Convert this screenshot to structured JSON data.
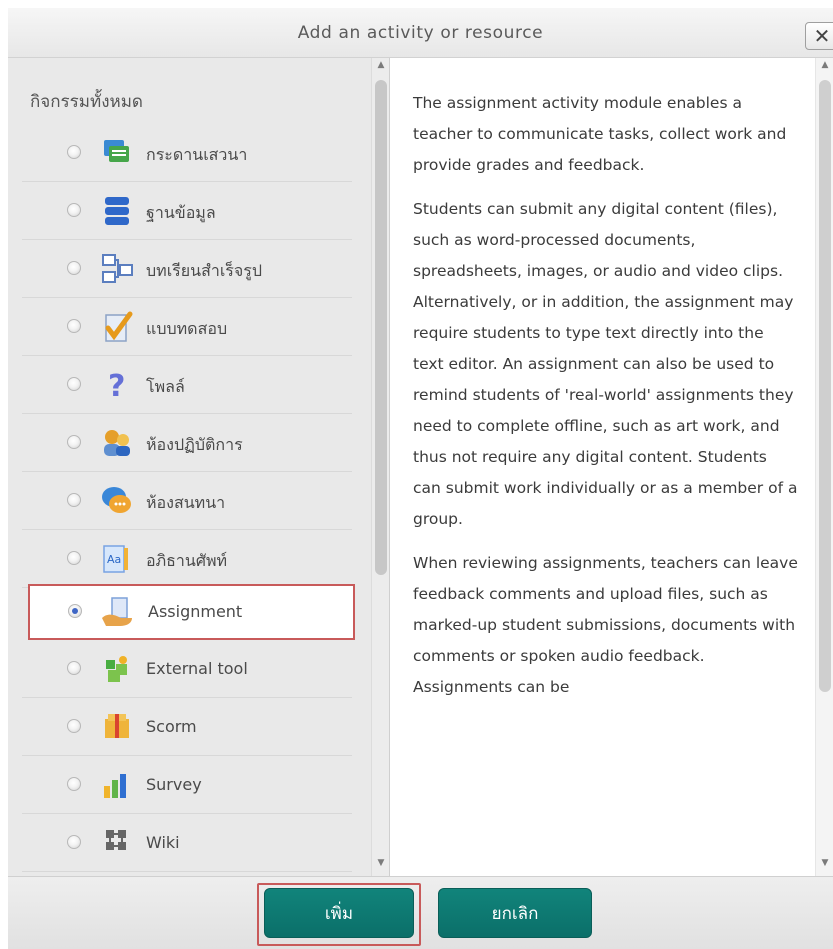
{
  "dialog": {
    "title": "Add an activity or resource",
    "close_label": "✕"
  },
  "left_panel": {
    "heading": "กิจกรรมทั้งหมด",
    "items": [
      {
        "label": "กระดานเสวนา",
        "icon": "forum-icon"
      },
      {
        "label": "ฐานข้อมูล",
        "icon": "database-icon"
      },
      {
        "label": "บทเรียนสำเร็จรูป",
        "icon": "lesson-icon"
      },
      {
        "label": "แบบทดสอบ",
        "icon": "quiz-icon"
      },
      {
        "label": "โพลล์",
        "icon": "poll-icon"
      },
      {
        "label": "ห้องปฏิบัติการ",
        "icon": "workshop-icon"
      },
      {
        "label": "ห้องสนทนา",
        "icon": "chat-icon"
      },
      {
        "label": "อภิธานศัพท์",
        "icon": "glossary-icon"
      },
      {
        "label": "Assignment",
        "icon": "assignment-icon",
        "selected": true
      },
      {
        "label": "External tool",
        "icon": "external-tool-icon"
      },
      {
        "label": "Scorm",
        "icon": "scorm-icon"
      },
      {
        "label": "Survey",
        "icon": "survey-icon"
      },
      {
        "label": "Wiki",
        "icon": "wiki-icon"
      }
    ]
  },
  "description": {
    "paragraphs": [
      "The assignment activity module enables a teacher to communicate tasks, collect work and provide grades and feedback.",
      "Students can submit any digital content (files), such as word-processed documents, spreadsheets, images, or audio and video clips. Alternatively, or in addition, the assignment may require students to type text directly into the text editor. An assignment can also be used to remind students of 'real-world' assignments they need to complete offline, such as art work, and thus not require any digital content. Students can submit work individually or as a member of a group.",
      "When reviewing assignments, teachers can leave feedback comments and upload files, such as marked-up student submissions, documents with comments or spoken audio feedback. Assignments can be"
    ]
  },
  "footer": {
    "add_label": "เพิ่ม",
    "cancel_label": "ยกเลิก"
  },
  "colors": {
    "accent": "#0b6f69",
    "highlight_border": "#c85a5a"
  }
}
